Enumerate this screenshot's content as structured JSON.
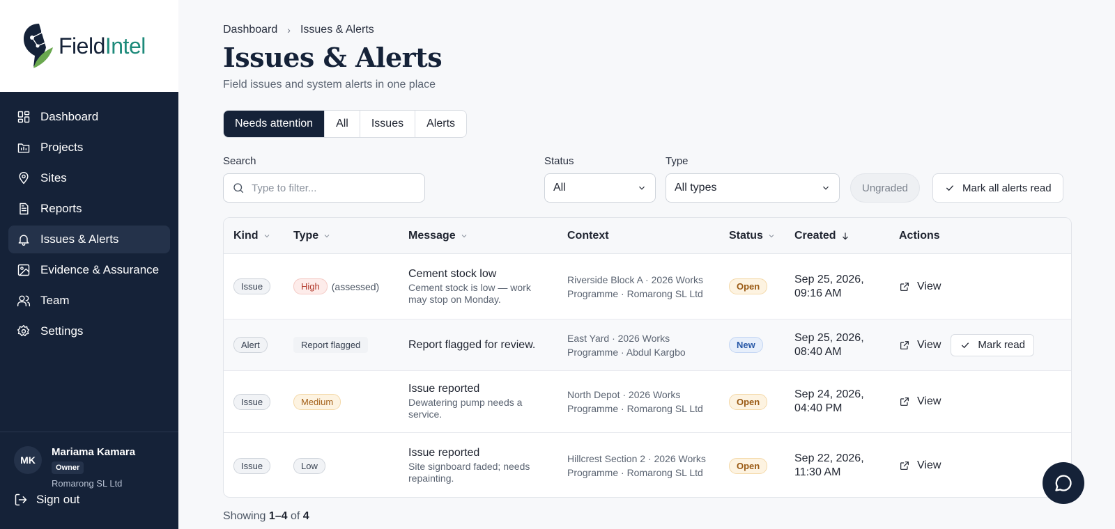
{
  "brand": {
    "name_part1": "Field",
    "name_part2": "Intel",
    "color_primary": "#152238",
    "color_accent": "#1d8a7a"
  },
  "sidebar": {
    "items": [
      {
        "label": "Dashboard",
        "icon": "grid-icon"
      },
      {
        "label": "Projects",
        "icon": "folder-icon"
      },
      {
        "label": "Sites",
        "icon": "map-pin-icon"
      },
      {
        "label": "Reports",
        "icon": "document-icon"
      },
      {
        "label": "Issues & Alerts",
        "icon": "bell-icon",
        "active": true
      },
      {
        "label": "Evidence & Assurance",
        "icon": "image-icon"
      },
      {
        "label": "Team",
        "icon": "users-icon"
      },
      {
        "label": "Settings",
        "icon": "gear-icon"
      }
    ],
    "user": {
      "initials": "MK",
      "name": "Mariama Kamara",
      "role": "Owner",
      "org": "Romarong SL Ltd"
    },
    "signout_label": "Sign out"
  },
  "header": {
    "breadcrumb": [
      "Dashboard",
      "Issues & Alerts"
    ],
    "title": "Issues & Alerts",
    "subtitle": "Field issues and system alerts in one place"
  },
  "tabs": [
    {
      "label": "Needs attention",
      "active": true
    },
    {
      "label": "All"
    },
    {
      "label": "Issues"
    },
    {
      "label": "Alerts"
    }
  ],
  "filters": {
    "search_label": "Search",
    "search_placeholder": "Type to filter...",
    "search_value": "",
    "status_label": "Status",
    "status_value": "All",
    "type_label": "Type",
    "type_value": "All types",
    "ungraded_label": "Ungraded",
    "mark_all_label": "Mark all alerts read"
  },
  "table": {
    "columns": [
      "Kind",
      "Type",
      "Message",
      "Context",
      "Status",
      "Created",
      "Actions"
    ],
    "view_label": "View",
    "mark_read_label": "Mark read",
    "rows": [
      {
        "kind": "Issue",
        "type": "High",
        "type_note": "(assessed)",
        "title": "Cement stock low",
        "sub": "Cement stock is low — work may stop on Monday.",
        "context": "Riverside Block A · 2026 Works Programme · Romarong SL Ltd",
        "status": "Open",
        "created": "Sep 25, 2026, 09:16 AM"
      },
      {
        "kind": "Alert",
        "type": "Report flagged",
        "type_note": "",
        "title": "Report flagged for review.",
        "sub": "",
        "context": "East Yard · 2026 Works Programme · Abdul Kargbo",
        "status": "New",
        "created": "Sep 25, 2026, 08:40 AM"
      },
      {
        "kind": "Issue",
        "type": "Medium",
        "type_note": "",
        "title": "Issue reported",
        "sub": "Dewatering pump needs a service.",
        "context": "North Depot · 2026 Works Programme · Romarong SL Ltd",
        "status": "Open",
        "created": "Sep 24, 2026, 04:40 PM"
      },
      {
        "kind": "Issue",
        "type": "Low",
        "type_note": "",
        "title": "Issue reported",
        "sub": "Site signboard faded; needs repainting.",
        "context": "Hillcrest Section 2 · 2026 Works Programme · Romarong SL Ltd",
        "status": "Open",
        "created": "Sep 22, 2026, 11:30 AM"
      }
    ]
  },
  "footer": {
    "showing_prefix": "Showing",
    "showing_range": "1–4",
    "showing_of": "of",
    "showing_total": "4"
  }
}
